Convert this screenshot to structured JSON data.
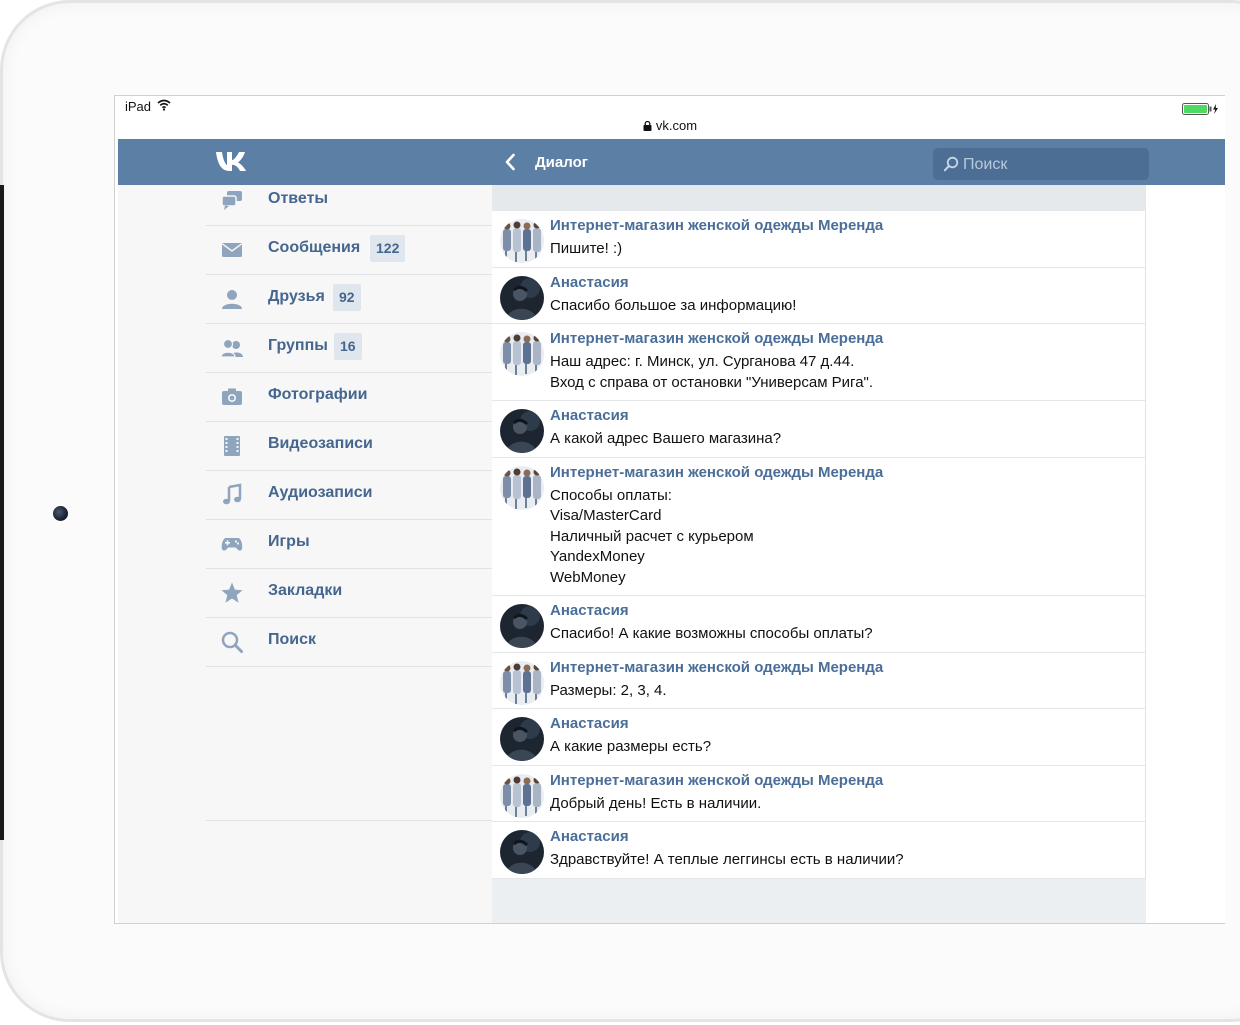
{
  "status_bar": {
    "device": "iPad",
    "url": "vk.com"
  },
  "header": {
    "title": "Диалог",
    "search_placeholder": "Поиск"
  },
  "sidebar": {
    "items": [
      {
        "label": "Ответы",
        "icon": "speech-bubbles-icon"
      },
      {
        "label": "Сообщения",
        "count": "122",
        "icon": "envelope-icon"
      },
      {
        "label": "Друзья",
        "count": "92",
        "icon": "person-icon"
      },
      {
        "label": "Группы",
        "count": "16",
        "icon": "group-icon"
      },
      {
        "label": "Фотографии",
        "icon": "camera-icon"
      },
      {
        "label": "Видеозаписи",
        "icon": "film-icon"
      },
      {
        "label": "Аудиозаписи",
        "icon": "music-note-icon"
      },
      {
        "label": "Игры",
        "icon": "gamepad-icon"
      },
      {
        "label": "Закладки",
        "icon": "star-icon"
      },
      {
        "label": "Поиск",
        "icon": "search-icon"
      }
    ]
  },
  "messages": [
    {
      "author": "Интернет-магазин женской одежды Меренда",
      "text": "Пишите! :)",
      "avatar": "shop"
    },
    {
      "author": "Анастасия",
      "text": "Спасибо большое за информацию!",
      "avatar": "user"
    },
    {
      "author": "Интернет-магазин женской одежды Меренда",
      "text": "Наш адрес: г. Минск, ул. Сурганова 47 д.44.\nВход с справа от остановки \"Универсам Рига\".",
      "avatar": "shop"
    },
    {
      "author": "Анастасия",
      "text": "А какой адрес Вашего магазина?",
      "avatar": "user"
    },
    {
      "author": "Интернет-магазин женской одежды Меренда",
      "text": "Способы оплаты:\nVisa/MasterCard\nНаличный расчет с курьером\nYandexMoney\nWebMoney",
      "avatar": "shop"
    },
    {
      "author": "Анастасия",
      "text": "Спасибо! А какие возможны способы оплаты?",
      "avatar": "user"
    },
    {
      "author": "Интернет-магазин женской одежды Меренда",
      "text": "Размеры: 2, 3, 4.",
      "avatar": "shop"
    },
    {
      "author": "Анастасия",
      "text": "А какие размеры есть?",
      "avatar": "user"
    },
    {
      "author": "Интернет-магазин женской одежды Меренда",
      "text": "Добрый день! Есть в наличии.",
      "avatar": "shop"
    },
    {
      "author": "Анастасия",
      "text": "Здравствуйте! А теплые леггинсы есть в наличии?",
      "avatar": "user"
    }
  ],
  "colors": {
    "header": "#5c7fa6",
    "link": "#45668e",
    "icon": "#8fa4bd"
  }
}
